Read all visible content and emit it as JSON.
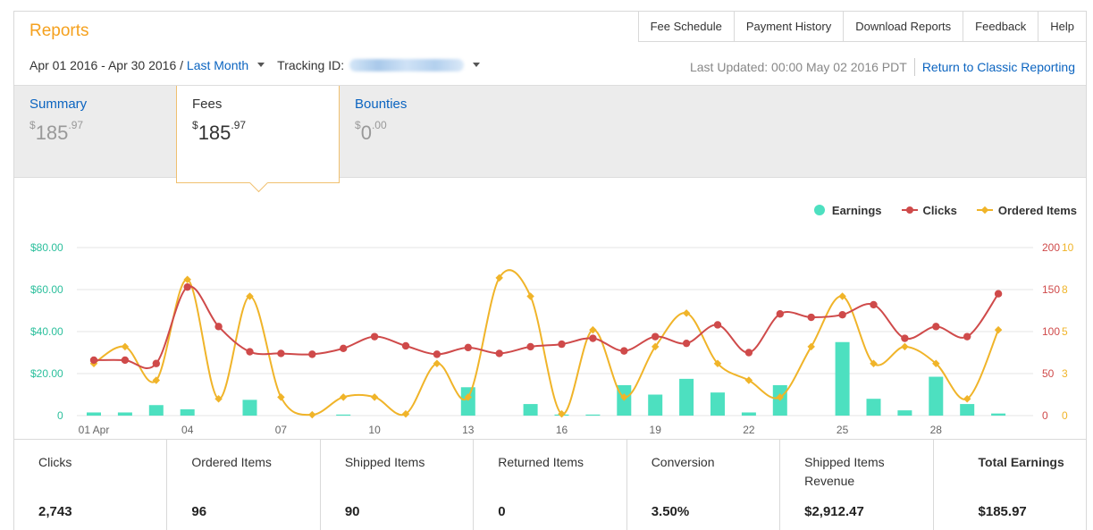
{
  "header": {
    "title": "Reports",
    "nav": [
      "Fee Schedule",
      "Payment History",
      "Download Reports",
      "Feedback",
      "Help"
    ],
    "date_range": "Apr 01 2016 - Apr 30 2016",
    "date_sep": " / ",
    "period_link": "Last Month",
    "tracking_label": "Tracking ID:",
    "last_updated": "Last Updated: 00:00 May 02 2016 PDT",
    "classic_link": "Return to Classic Reporting"
  },
  "tabs": [
    {
      "label": "Summary",
      "currency": "$",
      "whole": "185",
      "cents": ".97"
    },
    {
      "label": "Fees",
      "currency": "$",
      "whole": "185",
      "cents": ".97"
    },
    {
      "label": "Bounties",
      "currency": "$",
      "whole": "0",
      "cents": ".00"
    }
  ],
  "legend": {
    "earnings": "Earnings",
    "clicks": "Clicks",
    "ordered": "Ordered Items"
  },
  "colors": {
    "earnings": "#4de0c0",
    "clicks": "#cf4a4a",
    "ordered": "#f0b429",
    "accent": "#f5a11e",
    "link": "#0b64c0"
  },
  "chart_data": {
    "type": "bar+line",
    "categories": [
      "01 Apr",
      "02",
      "03",
      "04",
      "05",
      "06",
      "07",
      "08",
      "09",
      "10",
      "11",
      "12",
      "13",
      "14",
      "15",
      "16",
      "17",
      "18",
      "19",
      "20",
      "21",
      "22",
      "23",
      "24",
      "25",
      "26",
      "27",
      "28",
      "29",
      "30"
    ],
    "x_tick_labels": [
      "01 Apr",
      "04",
      "07",
      "10",
      "13",
      "16",
      "19",
      "22",
      "25",
      "28"
    ],
    "x_tick_index": [
      0,
      3,
      6,
      9,
      12,
      15,
      18,
      21,
      24,
      27
    ],
    "left_axis": {
      "ticks": [
        "0",
        "$20.00",
        "$40.00",
        "$60.00",
        "$80.00"
      ],
      "ylim": [
        0,
        80
      ]
    },
    "right_axis_clicks": {
      "ticks": [
        "0",
        "50",
        "100",
        "150",
        "200"
      ],
      "ylim": [
        0,
        200
      ]
    },
    "right_axis_ordered": {
      "ticks": [
        "0",
        "3",
        "5",
        "8",
        "10"
      ],
      "ylim": [
        0,
        10
      ]
    },
    "series": [
      {
        "name": "Earnings",
        "axis": "left",
        "kind": "bar",
        "values": [
          1.5,
          1.5,
          5,
          3,
          0,
          7.5,
          0,
          0,
          0.5,
          0,
          0,
          0,
          13.5,
          0,
          5.5,
          0.5,
          0.5,
          14.5,
          10,
          17.5,
          11,
          1.5,
          14.5,
          0,
          35,
          8,
          2.5,
          18.5,
          5.5,
          1
        ]
      },
      {
        "name": "Clicks",
        "axis": "right",
        "kind": "line",
        "values": [
          66,
          66,
          62,
          153,
          106,
          76,
          74,
          73,
          80,
          94,
          83,
          73,
          81,
          74,
          82,
          85,
          92,
          77,
          94,
          86,
          108,
          75,
          121,
          117,
          120,
          132,
          92,
          106,
          94,
          145
        ]
      },
      {
        "name": "Ordered Items",
        "axis": "right",
        "kind": "line",
        "values": [
          3.1,
          4.1,
          2.1,
          8.1,
          1.0,
          7.1,
          1.1,
          0.05,
          1.1,
          1.1,
          0.1,
          3.1,
          1.1,
          8.2,
          7.1,
          0.1,
          5.1,
          1.1,
          4.1,
          6.1,
          3.1,
          2.1,
          1.1,
          4.1,
          7.1,
          3.1,
          4.1,
          3.1,
          1.0,
          5.1
        ]
      }
    ]
  },
  "stats": [
    {
      "label": "Clicks",
      "value": "2,743"
    },
    {
      "label": "Ordered Items",
      "value": "96"
    },
    {
      "label": "Shipped Items",
      "value": "90"
    },
    {
      "label": "Returned Items",
      "value": "0"
    },
    {
      "label": "Conversion",
      "value": "3.50%"
    },
    {
      "label": "Shipped Items Revenue",
      "value": "$2,912.47"
    },
    {
      "label": "Total Earnings",
      "value": "$185.97"
    }
  ]
}
